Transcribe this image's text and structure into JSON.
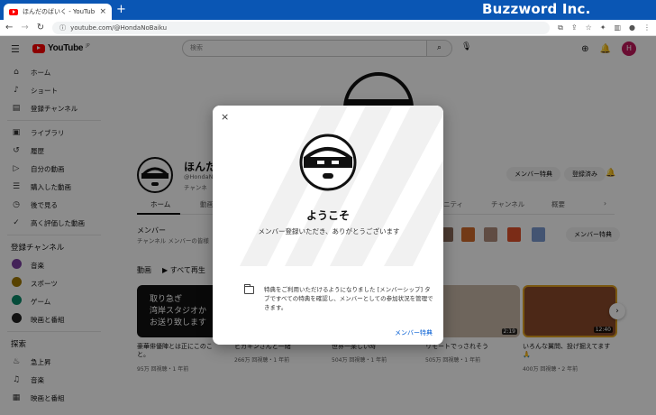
{
  "browser": {
    "tab_title": "ほんだのばいく - YouTube",
    "tab_close": "×",
    "new_tab": "+",
    "brand": "Buzzword Inc.",
    "url": "youtube.com/@HondaNoBaiku",
    "window_controls": "─   ☐   ✕"
  },
  "youtube": {
    "logo_text": "YouTube",
    "logo_region": "JP",
    "search_placeholder": "検索",
    "avatar_letter": "H"
  },
  "sidebar": {
    "items_top": [
      {
        "icon": "home-icon",
        "glyph": "⌂",
        "label": "ホーム"
      },
      {
        "icon": "shorts-icon",
        "glyph": "♪",
        "label": "ショート"
      },
      {
        "icon": "subscriptions-icon",
        "glyph": "▤",
        "label": "登録チャンネル"
      }
    ],
    "items_library": [
      {
        "icon": "library-icon",
        "glyph": "▣",
        "label": "ライブラリ"
      },
      {
        "icon": "history-icon",
        "glyph": "↺",
        "label": "履歴"
      },
      {
        "icon": "your-videos-icon",
        "glyph": "▷",
        "label": "自分の動画"
      },
      {
        "icon": "purchases-icon",
        "glyph": "☰",
        "label": "購入した動画"
      },
      {
        "icon": "watch-later-icon",
        "glyph": "◷",
        "label": "後で見る"
      },
      {
        "icon": "liked-icon",
        "glyph": "✓",
        "label": "高く評価した動画"
      }
    ],
    "subs_header": "登録チャンネル",
    "subs": [
      {
        "label": "音楽",
        "color": "#7b3fa0"
      },
      {
        "label": "スポーツ",
        "color": "#a07800"
      },
      {
        "label": "ゲーム",
        "color": "#0a8a6a"
      },
      {
        "label": "映画と番組",
        "color": "#222222"
      }
    ],
    "explore_header": "探索",
    "explore": [
      {
        "icon": "trending-icon",
        "glyph": "♨",
        "label": "急上昇"
      },
      {
        "icon": "music-icon",
        "glyph": "♫",
        "label": "音楽"
      },
      {
        "icon": "movies-icon",
        "glyph": "▦",
        "label": "映画と番組"
      }
    ]
  },
  "channel": {
    "name": "ほんた",
    "handle": "@HondaN",
    "channel_label": "チャンネ",
    "join_button": "メンバー特典",
    "subscribed_button": "登録済み",
    "tabs": [
      "ホーム",
      "動画",
      "ニティ",
      "チャンネル",
      "概要"
    ],
    "members_title": "メンバー",
    "members_sub": "チャンネル メンバーの皆様",
    "members_button": "メンバー特典",
    "section_title": "動画",
    "play_all": "すべて再生",
    "thumb1_text": "取り急ぎ\n湾岸スタジオか\nお送り致します",
    "videos": [
      {
        "title": "豪華俳優陣とは正にこのこ\nと。",
        "meta": "95万 回視聴・1 年前",
        "duration": ""
      },
      {
        "title": "ヒカキンさんと一緒",
        "meta": "266万 回視聴・1 年前",
        "duration": ""
      },
      {
        "title": "世界一楽しい時",
        "meta": "504万 回視聴・1 年前",
        "duration": ""
      },
      {
        "title": "リモートでっされそう",
        "meta": "505万 回視聴・1 年前",
        "duration": "2:19"
      },
      {
        "title": "いろんな翼問、投げ掘えてます🙏",
        "meta": "400万 回視聴・2 年前",
        "duration": "12:40"
      }
    ]
  },
  "modal": {
    "close": "×",
    "title": "ようこそ",
    "message": "メンバー登録いただき、ありがとうございます",
    "benefit_text": "特典をご利用いただけるようになりました [メンバーシップ] タブですべての特典を確認し、メンバーとしての参加状況を管理できます。",
    "benefit_link": "メンバー特典"
  }
}
